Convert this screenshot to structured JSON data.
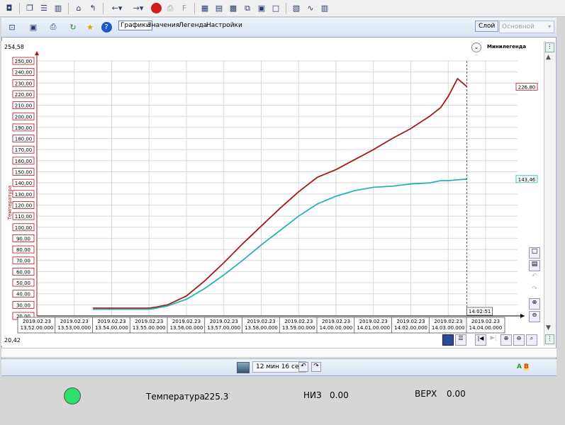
{
  "toolbar2": {
    "tabs": [
      "Графики",
      "Значения",
      "Легенда",
      "Настройки"
    ],
    "layer_button": "Слой",
    "layer_select": "Основной"
  },
  "chart": {
    "top_value": "254,58",
    "bottom_value": "20,42",
    "minilegend": "Минилегенда",
    "y_axis_label": "Температура",
    "cursor_time": "14:02:51",
    "value_red": "226,80",
    "value_teal": "143,46",
    "colors": {
      "red": "#a31a1a",
      "teal": "#2ab3b3",
      "axis": "#a31a1a"
    }
  },
  "chart_data": {
    "type": "line",
    "ylabel": "Температура",
    "ylim": [
      20,
      250
    ],
    "yticks": [
      "20,00",
      "30,00",
      "40,00",
      "50,00",
      "60,00",
      "70,00",
      "80,00",
      "90,00",
      "100,00",
      "110,00",
      "120,00",
      "130,00",
      "140,00",
      "150,00",
      "160,00",
      "170,00",
      "180,00",
      "190,00",
      "200,00",
      "210,00",
      "220,00",
      "230,00",
      "240,00",
      "250,00"
    ],
    "xticks": [
      [
        "2019.02.23",
        "13.52.00.000"
      ],
      [
        "2019.02.23",
        "13.53.00.000"
      ],
      [
        "2019.02.23",
        "13.54.00.000"
      ],
      [
        "2019.02.23",
        "13.55.00.000"
      ],
      [
        "2019.02.23",
        "13.56.00.000"
      ],
      [
        "2019.02.23",
        "13.57.00.000"
      ],
      [
        "2019.02.23",
        "13.58.00.000"
      ],
      [
        "2019.02.23",
        "13.59.00.000"
      ],
      [
        "2019.02.23",
        "14.00.00.000"
      ],
      [
        "2019.02.23",
        "14.01.00.000"
      ],
      [
        "2019.02.23",
        "14.02.00.000"
      ],
      [
        "2019.02.23",
        "14.03.00.000"
      ],
      [
        "2019.02.23",
        "14.04.00.000"
      ]
    ],
    "xlim_min": [
      0,
      12
    ],
    "series": [
      {
        "color": "#a31a1a",
        "x": [
          1.5,
          2.0,
          2.5,
          3.0,
          3.2,
          3.5,
          4.0,
          4.5,
          5.0,
          5.5,
          6.0,
          6.5,
          7.0,
          7.5,
          8.0,
          8.5,
          9.0,
          9.5,
          10.0,
          10.5,
          10.8,
          11.0,
          11.25,
          11.5
        ],
        "y": [
          27,
          27,
          27,
          27,
          28,
          30,
          38,
          52,
          68,
          85,
          101,
          117,
          132,
          145,
          152,
          161,
          170,
          180,
          189,
          200,
          208,
          218,
          234,
          226.8
        ]
      },
      {
        "color": "#2ab3b3",
        "x": [
          1.5,
          2.0,
          2.5,
          3.0,
          3.2,
          3.5,
          4.0,
          4.5,
          5.0,
          5.5,
          6.0,
          6.5,
          7.0,
          7.5,
          8.0,
          8.5,
          9.0,
          9.5,
          10.0,
          10.5,
          10.8,
          11.0,
          11.5
        ],
        "y": [
          26,
          26,
          26,
          26,
          27,
          29,
          35,
          45,
          57,
          70,
          84,
          97,
          110,
          121,
          128,
          133,
          136,
          137,
          139,
          140,
          142,
          142,
          143.46
        ]
      }
    ]
  },
  "bottom": {
    "duration": "12 мин 16 сек",
    "ab_label_a": "A",
    "ab_label_b": "B"
  },
  "footer": {
    "temp_label": "Температура",
    "temp_value": "225.37",
    "low_label": "НИЗ",
    "low_value": "0.00",
    "high_label": "ВЕРХ",
    "high_value": "0.00",
    "indicator_color": "#2ee06a"
  }
}
